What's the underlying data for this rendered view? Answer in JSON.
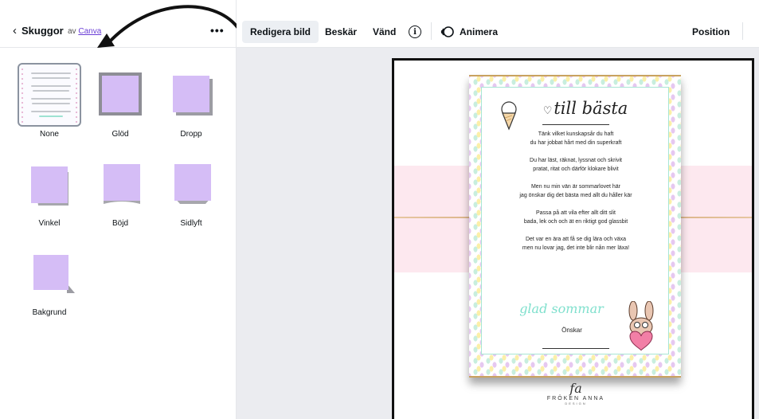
{
  "panel": {
    "back_chevron": "‹",
    "title": "Skuggor",
    "byline_prefix": "av",
    "byline_link": "Canva",
    "more": "•••"
  },
  "shadow_options": [
    {
      "label": "None"
    },
    {
      "label": "Glöd"
    },
    {
      "label": "Dropp"
    },
    {
      "label": "Vinkel"
    },
    {
      "label": "Böjd"
    },
    {
      "label": "Sidlyft"
    },
    {
      "label": "Bakgrund"
    }
  ],
  "toolbar": {
    "edit_image": "Redigera bild",
    "crop": "Beskär",
    "flip": "Vänd",
    "info": "i",
    "animate": "Animera",
    "position": "Position"
  },
  "design": {
    "title": "till bästa",
    "heart": "♡",
    "poem": [
      "Tänk vilket kunskapsår du haft\ndu har jobbat hårt med din superkraft",
      "Du har läst, räknat, lyssnat och skrivit\npratat, ritat och därför klokare blivit",
      "Men nu min vän är sommarlovet här\njag önskar dig det bästa med allt du håller kär",
      "Passa på att vila efter allt ditt slit\nbada, lek och och ät en riktigt god glassbit",
      "Det var en ära att få se dig lära och växa\nmen nu lovar jag, det inte blir nån mer läxa!"
    ],
    "greeting": "glad sommar",
    "signoff": "Önskar",
    "logo_mark": "fa",
    "logo_name": "FRÖKEN ANNA",
    "logo_sub": "DESIGN"
  },
  "colors": {
    "swatch": "#d5bdf6",
    "accent_link": "#6b3fd6",
    "canvas_bg": "#ebecf0"
  }
}
